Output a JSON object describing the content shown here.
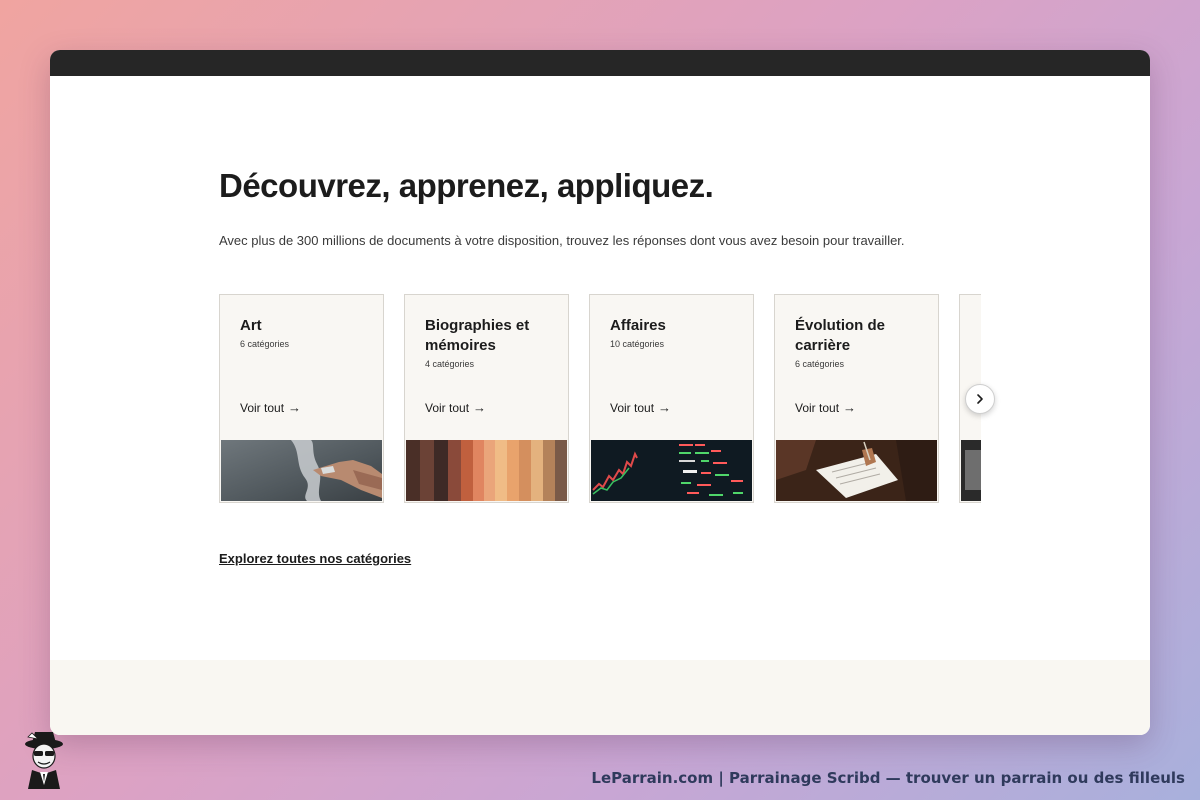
{
  "page": {
    "heading": "Découvrez, apprenez, appliquez.",
    "subtext": "Avec plus de 300 millions de documents à votre disposition, trouvez les réponses dont vous avez besoin pour travailler."
  },
  "categories": [
    {
      "title": "Art",
      "count": "6 catégories",
      "link": "Voir tout"
    },
    {
      "title": "Biographies et mémoires",
      "count": "4 catégories",
      "link": "Voir tout"
    },
    {
      "title": "Affaires",
      "count": "10 catégories",
      "link": "Voir tout"
    },
    {
      "title": "Évolution de carrière",
      "count": "6 catégories",
      "link": "Voir tout"
    }
  ],
  "carousel": {
    "next_icon": "chevron-right-icon",
    "arrow_icon": "arrow-right-icon"
  },
  "explore_link": "Explorez toutes nos catégories",
  "watermark": {
    "text": "LeParrain.com | Parrainage Scribd — trouver un parrain ou des filleuls",
    "mascot_icon": "mascot-icon"
  },
  "colors": {
    "topbar": "#262626",
    "card_bg": "#f9f7f3",
    "footer_band": "#f9f7f2",
    "watermark_text": "#2f3a5c"
  }
}
